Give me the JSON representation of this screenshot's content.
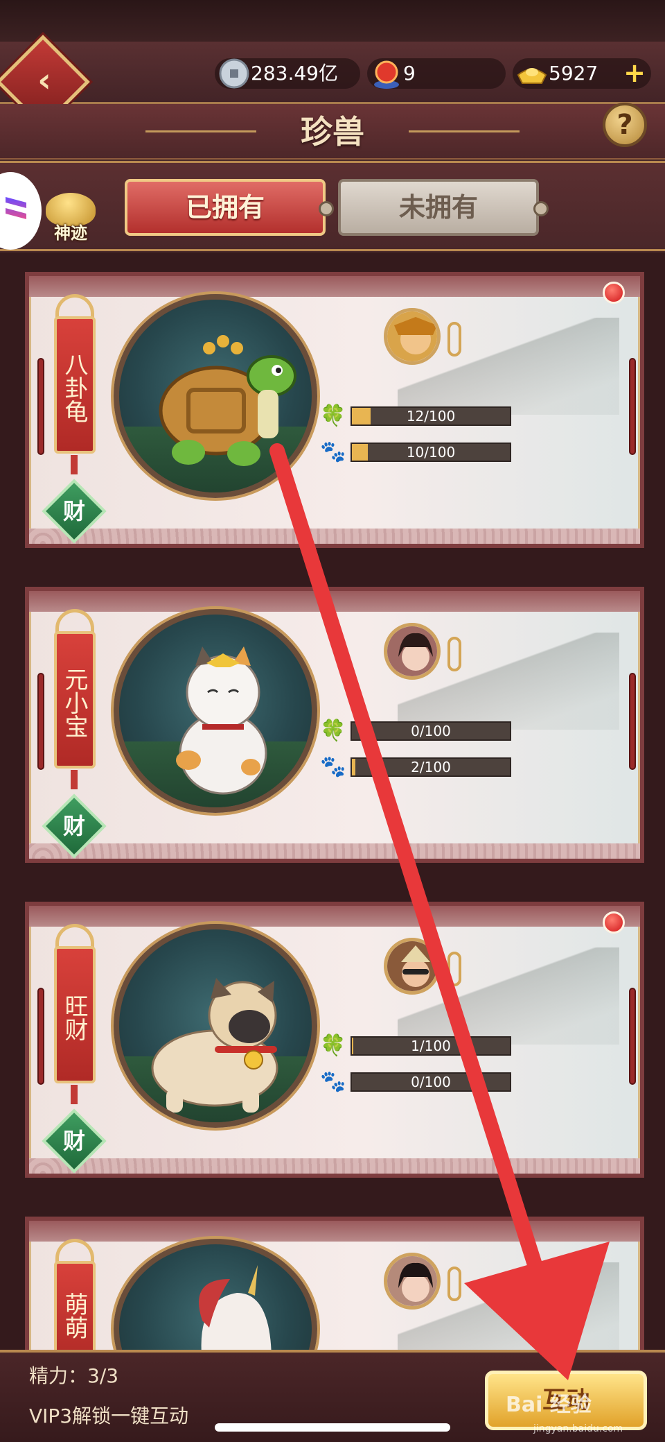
{
  "header": {
    "title": "珍兽",
    "back_icon": "back-diamond-icon",
    "help_label": "?"
  },
  "resources": {
    "silver": {
      "value": "283.49亿",
      "icon": "silver-coin-icon"
    },
    "orb": {
      "value": "9",
      "icon": "red-orb-icon"
    },
    "gold": {
      "value": "5927",
      "icon": "gold-ingot-icon",
      "add_label": "+"
    }
  },
  "side": {
    "shenji_label": "神迹"
  },
  "tabs": [
    {
      "label": "已拥有",
      "active": true
    },
    {
      "label": "未拥有",
      "active": false
    }
  ],
  "pets": [
    {
      "name": "八卦龟",
      "badge": "财",
      "stat1": {
        "text": "12/100",
        "value": 12,
        "max": 100
      },
      "stat2": {
        "text": "10/100",
        "value": 10,
        "max": 100
      },
      "has_red_dot": true
    },
    {
      "name": "元小宝",
      "badge": "财",
      "stat1": {
        "text": "0/100",
        "value": 0,
        "max": 100
      },
      "stat2": {
        "text": "2/100",
        "value": 2,
        "max": 100
      },
      "has_red_dot": false
    },
    {
      "name": "旺财",
      "badge": "财",
      "stat1": {
        "text": "1/100",
        "value": 1,
        "max": 100
      },
      "stat2": {
        "text": "0/100",
        "value": 0,
        "max": 100
      },
      "has_red_dot": true
    },
    {
      "name": "萌萌",
      "badge": "",
      "has_red_dot": false
    }
  ],
  "stat_icons": {
    "stat1": "clover-icon",
    "stat2": "paw-icon"
  },
  "bottom": {
    "energy_label": "精力：3/3",
    "vip_label": "VIP3解锁一键互动",
    "button_label": "互动"
  },
  "watermark": {
    "text": "Bai 经验",
    "sub": "jingyan.baidu.com"
  },
  "colors": {
    "accent_red": "#c23a36",
    "gold": "#e8b552",
    "annotation_arrow": "#e8383a"
  }
}
